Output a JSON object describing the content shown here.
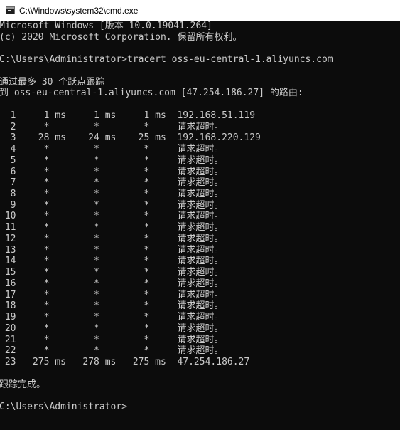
{
  "window": {
    "title": "C:\\Windows\\system32\\cmd.exe",
    "icon": "cmd-console-icon"
  },
  "console": {
    "lines": [
      "Microsoft Windows [版本 10.0.19041.264]",
      "(c) 2020 Microsoft Corporation. 保留所有权利。",
      "",
      "C:\\Users\\Administrator>tracert oss-eu-central-1.aliyuncs.com",
      "",
      "通过最多 30 个跃点跟踪",
      "到 oss-eu-central-1.aliyuncs.com [47.254.186.27] 的路由:",
      "",
      "  1     1 ms     1 ms     1 ms  192.168.51.119",
      "  2     *        *        *     请求超时。",
      "  3    28 ms    24 ms    25 ms  192.168.220.129",
      "  4     *        *        *     请求超时。",
      "  5     *        *        *     请求超时。",
      "  6     *        *        *     请求超时。",
      "  7     *        *        *     请求超时。",
      "  8     *        *        *     请求超时。",
      "  9     *        *        *     请求超时。",
      " 10     *        *        *     请求超时。",
      " 11     *        *        *     请求超时。",
      " 12     *        *        *     请求超时。",
      " 13     *        *        *     请求超时。",
      " 14     *        *        *     请求超时。",
      " 15     *        *        *     请求超时。",
      " 16     *        *        *     请求超时。",
      " 17     *        *        *     请求超时。",
      " 18     *        *        *     请求超时。",
      " 19     *        *        *     请求超时。",
      " 20     *        *        *     请求超时。",
      " 21     *        *        *     请求超时。",
      " 22     *        *        *     请求超时。",
      " 23   275 ms   278 ms   275 ms  47.254.186.27",
      "",
      "跟踪完成。",
      "",
      "C:\\Users\\Administrator>"
    ]
  },
  "colors": {
    "console_background": "#0c0c0c",
    "console_text": "#cccccc",
    "titlebar_background": "#ffffff"
  }
}
